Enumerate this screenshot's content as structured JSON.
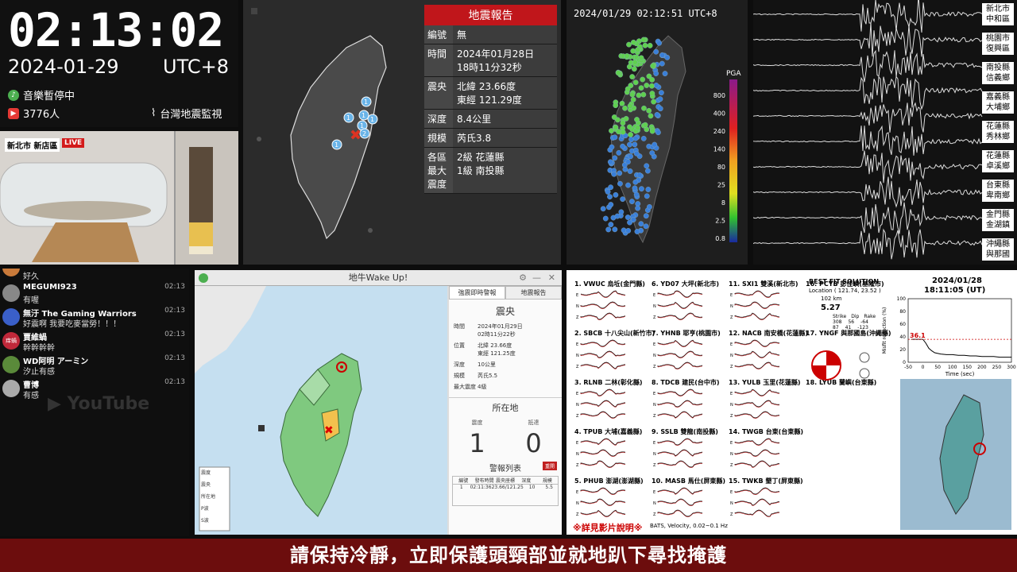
{
  "clock": {
    "time": "02:13:02",
    "date": "2024-01-29",
    "tz": "UTC+8",
    "music": "音樂暫停中",
    "viewers": "3776人",
    "brand": "台灣地震監視"
  },
  "cam": {
    "location": "新北市 新店區",
    "live": "LIVE"
  },
  "report": {
    "title": "地震報告",
    "rows": [
      {
        "k": "編號",
        "v": "無"
      },
      {
        "k": "時間",
        "v": "2024年01月28日\n18時11分32秒"
      },
      {
        "k": "震央",
        "v": "北緯 23.66度\n東經 121.29度"
      },
      {
        "k": "深度",
        "v": "8.4公里"
      },
      {
        "k": "規模",
        "v": "芮氏3.8"
      },
      {
        "k": "各區最大震度",
        "v": "2級 花蓮縣\n1級 南投縣"
      }
    ]
  },
  "map1_markers": [
    "1",
    "1",
    "1",
    "1",
    "2",
    "1",
    "1"
  ],
  "pga": {
    "timestamp": "2024/01/29 02:12:51 UTC+8",
    "label": "PGA",
    "ticks": [
      "800",
      "400",
      "240",
      "140",
      "80",
      "25",
      "8",
      "2.5",
      "0.8"
    ]
  },
  "stations": [
    [
      "新北市",
      "中和區"
    ],
    [
      "桃園市",
      "復興區"
    ],
    [
      "南投縣",
      "信義鄉"
    ],
    [
      "嘉義縣",
      "大埔鄉"
    ],
    [
      "花蓮縣",
      "秀林鄉"
    ],
    [
      "花蓮縣",
      "卓溪鄉"
    ],
    [
      "台東縣",
      "卑南鄉"
    ],
    [
      "金門縣",
      "金湖鎮"
    ],
    [
      "沖繩縣",
      "與那國"
    ]
  ],
  "chat": [
    {
      "name": "",
      "text": "好久",
      "time": ""
    },
    {
      "name": "MEGUMI923",
      "text": "有喔",
      "time": "02:13"
    },
    {
      "name": "無汙 The Gaming Warriors",
      "text": "好震啊 我要吃麥當勞！！！",
      "time": "02:13"
    },
    {
      "name": "賈維蝸",
      "text": "幹幹幹幹",
      "time": "02:13",
      "av": "痒蝸"
    },
    {
      "name": "WD阿明 アーミン",
      "text": "汐止有感",
      "time": "02:13"
    },
    {
      "name": "曹博",
      "text": "有感",
      "time": "02:13"
    }
  ],
  "app": {
    "title": "地牛Wake Up!",
    "tabs": [
      "強震即時警報",
      "地震報告"
    ],
    "epicenter_title": "震央",
    "fields": [
      {
        "k": "時間",
        "v": "2024年01月29日\n02時11分22秒"
      },
      {
        "k": "位置",
        "v": "北緯 23.66度\n東經 121.25度"
      },
      {
        "k": "深度",
        "v": "10公里"
      },
      {
        "k": "規模",
        "v": "芮氏5.5"
      },
      {
        "k": "最大震度",
        "v": "4級"
      }
    ],
    "location_title": "所在地",
    "intensity_label": "震度",
    "arrival_label": "抵達",
    "intensity": "1",
    "arrival": "0",
    "alert_title": "警報列表",
    "alert_btn": "重開",
    "alert_headers": [
      "編號",
      "發布時間",
      "震央座標",
      "深度",
      "規模"
    ],
    "alert_row": [
      "1",
      "02:11:36",
      "23.66/121.25",
      "10",
      "5.5"
    ],
    "legend": [
      "震度",
      "震央",
      "所在地",
      "P波",
      "S波"
    ]
  },
  "mech": {
    "stations": [
      "1. VWUC 烏坵(金門縣)",
      "2. SBCB 十八尖山(新竹市)",
      "3. RLNB 二林(彰化縣)",
      "4. TPUB 大埔(嘉義縣)",
      "5. PHUB 澎湖(澎湖縣)",
      "6. YD07 大坪(新北市)",
      "7. YHNB 耶亨(桃園市)",
      "8. TDCB 建民(台中市)",
      "9. SSLB 雙龍(南投縣)",
      "10. MASB 馬仕(屏東縣)",
      "11. SXI1 雙溪(新北市)",
      "12. NACB 南安橋(花蓮縣)",
      "13. YULB 玉里(花蓮縣)",
      "14. TWGB 台東(台東縣)",
      "15. TWKB 墾丁(屏東縣)",
      "16. PCYB 彭佳嶼(基隆市)",
      "17. YNGF 與那國島(沖繩縣)",
      "18. LYUB 蘭嶼(台東縣)"
    ],
    "best_fit": "BEST FIT SOLUTION",
    "location": "Location ( 121.74, 23.52 )",
    "depth": "102 km",
    "mw": "5.27",
    "planes": [
      "Strike",
      "Dip",
      "Rake"
    ],
    "plane1": [
      "308",
      "56",
      "-64"
    ],
    "plane2": [
      "87",
      "41",
      "-123"
    ],
    "chart_date": "2024/01/28",
    "chart_time": "18:11:05 (UT)",
    "peak": "36.1",
    "xlabel": "Time (sec)",
    "ylabel": "Misfit reduction (%)",
    "note": "※詳見影片說明※",
    "bats": "BATS, Velocity, 0.02~0.1 Hz"
  },
  "chart_data": {
    "type": "line",
    "title": "2024/01/28 18:11:05 (UT)",
    "xlabel": "Time (sec)",
    "ylabel": "Misfit reduction (%)",
    "xlim": [
      -50,
      300
    ],
    "ylim": [
      0,
      100
    ],
    "x": [
      -40,
      0,
      10,
      20,
      30,
      40,
      60,
      80,
      100,
      120,
      140,
      160,
      180,
      200,
      220,
      240,
      260,
      280,
      300
    ],
    "series": [
      {
        "values": [
          36.1,
          36.1,
          30,
          22,
          18,
          15,
          13,
          12,
          12,
          11,
          11,
          10,
          10,
          9,
          9,
          9,
          8,
          8,
          8
        ]
      }
    ]
  },
  "footer": "請保持冷靜，立即保護頭頸部並就地趴下尋找掩護"
}
